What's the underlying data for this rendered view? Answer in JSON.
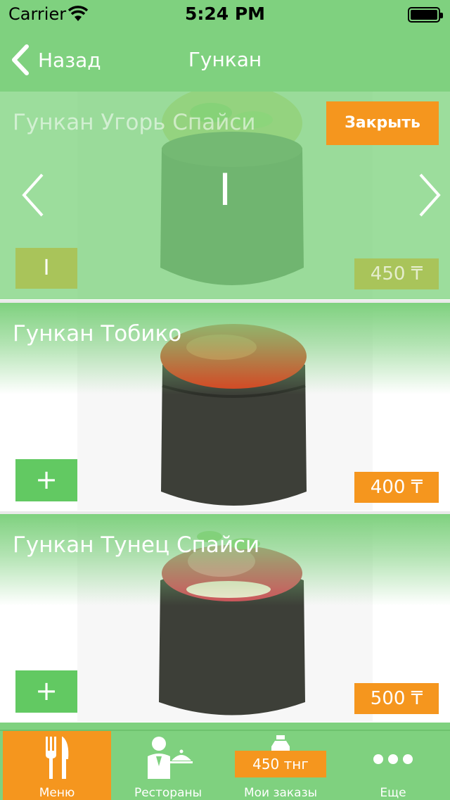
{
  "status": {
    "carrier": "Carrier",
    "time": "5:24 PM"
  },
  "nav": {
    "back_label": "Назад",
    "title": "Гункан"
  },
  "selected": {
    "name": "Гункан Угорь Спайси",
    "close_label": "Закрыть",
    "quantity": "I",
    "qty_button": "I",
    "price": "450 ₸"
  },
  "items": [
    {
      "name": "Гункан Тобико",
      "add_label": "+",
      "price": "400 ₸"
    },
    {
      "name": "Гункан Тунец Спайси",
      "add_label": "+",
      "price": "500 ₸"
    }
  ],
  "tabs": [
    {
      "label": "Меню",
      "icon": "fork-knife-icon",
      "active": true
    },
    {
      "label": "Рестораны",
      "icon": "waiter-icon"
    },
    {
      "label": "Мои заказы",
      "icon": "bottle-icon",
      "badge": "450 тнг"
    },
    {
      "label": "Еще",
      "icon": "more-dots-icon"
    }
  ],
  "colors": {
    "accent_green": "#7fd17f",
    "button_green": "#62c962",
    "orange": "#f5961e",
    "olive": "#a9c45a"
  }
}
